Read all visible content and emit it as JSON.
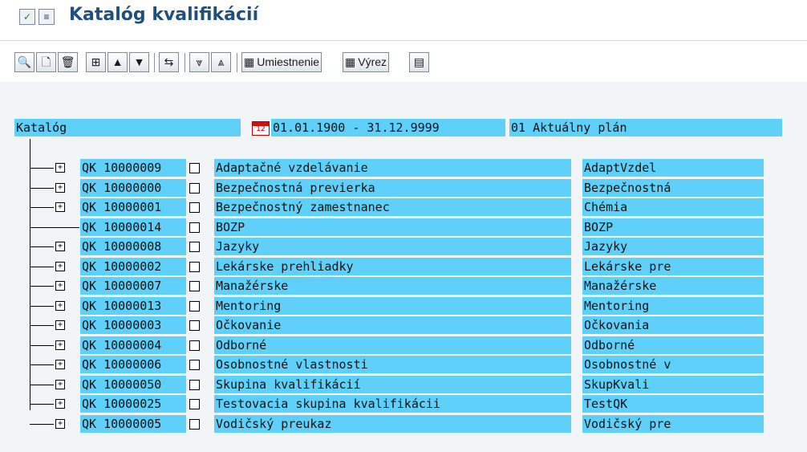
{
  "window": {
    "title": "Katalóg kvalifikácií"
  },
  "toolbar": {
    "umiestnenie_label": "Umiestnenie",
    "vyrez_label": "Výrez"
  },
  "header": {
    "catalog_label": "Katalóg",
    "date_range": "01.01.1900 - 31.12.9999",
    "plan_label": "01 Aktuálny plán"
  },
  "rows": [
    {
      "id": "QK 10000009",
      "name": "Adaptačné vzdelávanie",
      "short": "AdaptVzdel",
      "expandable": true
    },
    {
      "id": "QK 10000000",
      "name": "Bezpečnostná previerka",
      "short": "Bezpečnostná",
      "expandable": true
    },
    {
      "id": "QK 10000001",
      "name": "Bezpečnostný zamestnanec",
      "short": "Chémia",
      "expandable": true
    },
    {
      "id": "QK 10000014",
      "name": "BOZP",
      "short": "BOZP",
      "expandable": false
    },
    {
      "id": "QK 10000008",
      "name": "Jazyky",
      "short": "Jazyky",
      "expandable": true
    },
    {
      "id": "QK 10000002",
      "name": "Lekárske prehliadky",
      "short": "Lekárske pre",
      "expandable": true
    },
    {
      "id": "QK 10000007",
      "name": "Manažérske",
      "short": "Manažérske",
      "expandable": true
    },
    {
      "id": "QK 10000013",
      "name": "Mentoring",
      "short": "Mentoring",
      "expandable": true
    },
    {
      "id": "QK 10000003",
      "name": "Očkovanie",
      "short": "Očkovania",
      "expandable": true
    },
    {
      "id": "QK 10000004",
      "name": "Odborné",
      "short": "Odborné",
      "expandable": true
    },
    {
      "id": "QK 10000006",
      "name": "Osobnostné vlastnosti",
      "short": "Osobnostné v",
      "expandable": true
    },
    {
      "id": "QK 10000050",
      "name": "Skupina kvalifikácií",
      "short": "SkupKvali",
      "expandable": true
    },
    {
      "id": "QK 10000025",
      "name": "Testovacia skupina kvalifikácii",
      "short": "TestQK",
      "expandable": true
    },
    {
      "id": "QK 10000005",
      "name": "Vodičský preukaz",
      "short": "Vodičský pre",
      "expandable": true
    }
  ]
}
